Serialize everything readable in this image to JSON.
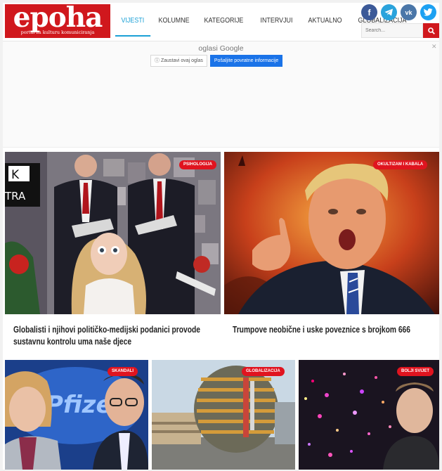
{
  "logo": {
    "word": "epoha",
    "tagline": "portal za kulturu komuniciranja"
  },
  "nav": [
    "VIJESTI",
    "KOLUMNE",
    "KATEGORIJE",
    "INTERVJUI",
    "AKTUALNO",
    "GLOBALIZACIJA"
  ],
  "social": {
    "facebook": "f",
    "telegram": "➤",
    "vk": "vk",
    "twitter": "🐦"
  },
  "search": {
    "placeholder": "Search..."
  },
  "ad": {
    "label": "oglasi Google",
    "stop": "Zaustavi ovaj oglas",
    "stop_prefix": "ⓘ",
    "why": "Pošaljite povratne informacije"
  },
  "featured": [
    {
      "badge": "PSIHOLOGIJA",
      "title": "Globalisti i njihovi političko-medijski podanici provode sustavnu kontrolu uma naše djece",
      "tv_text_1": "K",
      "tv_text_2": "TRA"
    },
    {
      "badge": "OKULTIZAM I KABALA",
      "title": "Trumpove neobične i uske poveznice s brojkom 666"
    }
  ],
  "row2": [
    {
      "badge": "SKANDALI",
      "brand": "Pfizer"
    },
    {
      "badge": "GLOBALIZACIJA"
    },
    {
      "badge": "BOLJI SVIJET"
    }
  ],
  "colors": {
    "brand": "#d0181d",
    "accent": "#1ba0d6",
    "badge": "#e0141f"
  }
}
